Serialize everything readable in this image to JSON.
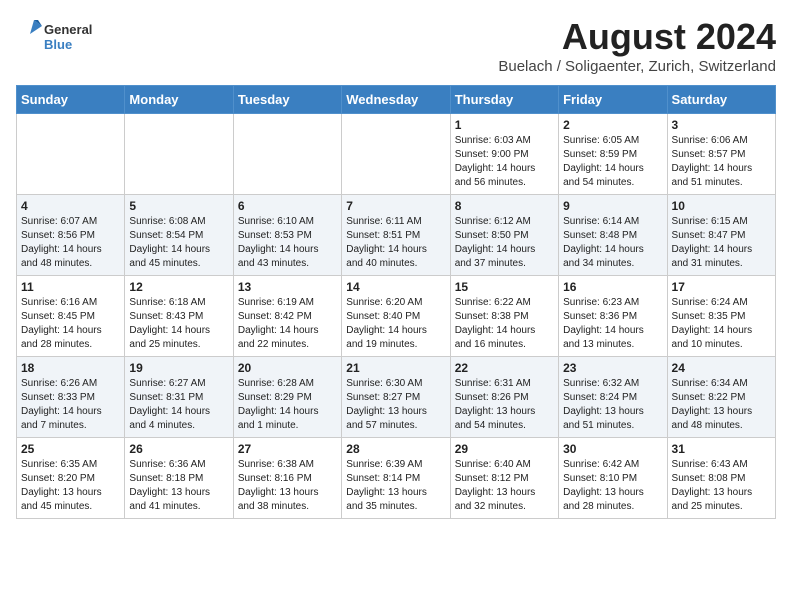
{
  "header": {
    "logo_general": "General",
    "logo_blue": "Blue",
    "title": "August 2024",
    "subtitle": "Buelach / Soligaenter, Zurich, Switzerland"
  },
  "weekdays": [
    "Sunday",
    "Monday",
    "Tuesday",
    "Wednesday",
    "Thursday",
    "Friday",
    "Saturday"
  ],
  "weeks": [
    [
      {
        "day": "",
        "info": ""
      },
      {
        "day": "",
        "info": ""
      },
      {
        "day": "",
        "info": ""
      },
      {
        "day": "",
        "info": ""
      },
      {
        "day": "1",
        "info": "Sunrise: 6:03 AM\nSunset: 9:00 PM\nDaylight: 14 hours and 56 minutes."
      },
      {
        "day": "2",
        "info": "Sunrise: 6:05 AM\nSunset: 8:59 PM\nDaylight: 14 hours and 54 minutes."
      },
      {
        "day": "3",
        "info": "Sunrise: 6:06 AM\nSunset: 8:57 PM\nDaylight: 14 hours and 51 minutes."
      }
    ],
    [
      {
        "day": "4",
        "info": "Sunrise: 6:07 AM\nSunset: 8:56 PM\nDaylight: 14 hours and 48 minutes."
      },
      {
        "day": "5",
        "info": "Sunrise: 6:08 AM\nSunset: 8:54 PM\nDaylight: 14 hours and 45 minutes."
      },
      {
        "day": "6",
        "info": "Sunrise: 6:10 AM\nSunset: 8:53 PM\nDaylight: 14 hours and 43 minutes."
      },
      {
        "day": "7",
        "info": "Sunrise: 6:11 AM\nSunset: 8:51 PM\nDaylight: 14 hours and 40 minutes."
      },
      {
        "day": "8",
        "info": "Sunrise: 6:12 AM\nSunset: 8:50 PM\nDaylight: 14 hours and 37 minutes."
      },
      {
        "day": "9",
        "info": "Sunrise: 6:14 AM\nSunset: 8:48 PM\nDaylight: 14 hours and 34 minutes."
      },
      {
        "day": "10",
        "info": "Sunrise: 6:15 AM\nSunset: 8:47 PM\nDaylight: 14 hours and 31 minutes."
      }
    ],
    [
      {
        "day": "11",
        "info": "Sunrise: 6:16 AM\nSunset: 8:45 PM\nDaylight: 14 hours and 28 minutes."
      },
      {
        "day": "12",
        "info": "Sunrise: 6:18 AM\nSunset: 8:43 PM\nDaylight: 14 hours and 25 minutes."
      },
      {
        "day": "13",
        "info": "Sunrise: 6:19 AM\nSunset: 8:42 PM\nDaylight: 14 hours and 22 minutes."
      },
      {
        "day": "14",
        "info": "Sunrise: 6:20 AM\nSunset: 8:40 PM\nDaylight: 14 hours and 19 minutes."
      },
      {
        "day": "15",
        "info": "Sunrise: 6:22 AM\nSunset: 8:38 PM\nDaylight: 14 hours and 16 minutes."
      },
      {
        "day": "16",
        "info": "Sunrise: 6:23 AM\nSunset: 8:36 PM\nDaylight: 14 hours and 13 minutes."
      },
      {
        "day": "17",
        "info": "Sunrise: 6:24 AM\nSunset: 8:35 PM\nDaylight: 14 hours and 10 minutes."
      }
    ],
    [
      {
        "day": "18",
        "info": "Sunrise: 6:26 AM\nSunset: 8:33 PM\nDaylight: 14 hours and 7 minutes."
      },
      {
        "day": "19",
        "info": "Sunrise: 6:27 AM\nSunset: 8:31 PM\nDaylight: 14 hours and 4 minutes."
      },
      {
        "day": "20",
        "info": "Sunrise: 6:28 AM\nSunset: 8:29 PM\nDaylight: 14 hours and 1 minute."
      },
      {
        "day": "21",
        "info": "Sunrise: 6:30 AM\nSunset: 8:27 PM\nDaylight: 13 hours and 57 minutes."
      },
      {
        "day": "22",
        "info": "Sunrise: 6:31 AM\nSunset: 8:26 PM\nDaylight: 13 hours and 54 minutes."
      },
      {
        "day": "23",
        "info": "Sunrise: 6:32 AM\nSunset: 8:24 PM\nDaylight: 13 hours and 51 minutes."
      },
      {
        "day": "24",
        "info": "Sunrise: 6:34 AM\nSunset: 8:22 PM\nDaylight: 13 hours and 48 minutes."
      }
    ],
    [
      {
        "day": "25",
        "info": "Sunrise: 6:35 AM\nSunset: 8:20 PM\nDaylight: 13 hours and 45 minutes."
      },
      {
        "day": "26",
        "info": "Sunrise: 6:36 AM\nSunset: 8:18 PM\nDaylight: 13 hours and 41 minutes."
      },
      {
        "day": "27",
        "info": "Sunrise: 6:38 AM\nSunset: 8:16 PM\nDaylight: 13 hours and 38 minutes."
      },
      {
        "day": "28",
        "info": "Sunrise: 6:39 AM\nSunset: 8:14 PM\nDaylight: 13 hours and 35 minutes."
      },
      {
        "day": "29",
        "info": "Sunrise: 6:40 AM\nSunset: 8:12 PM\nDaylight: 13 hours and 32 minutes."
      },
      {
        "day": "30",
        "info": "Sunrise: 6:42 AM\nSunset: 8:10 PM\nDaylight: 13 hours and 28 minutes."
      },
      {
        "day": "31",
        "info": "Sunrise: 6:43 AM\nSunset: 8:08 PM\nDaylight: 13 hours and 25 minutes."
      }
    ]
  ],
  "colors": {
    "header_bg": "#3a7fc1",
    "accent": "#3a7fc1"
  }
}
